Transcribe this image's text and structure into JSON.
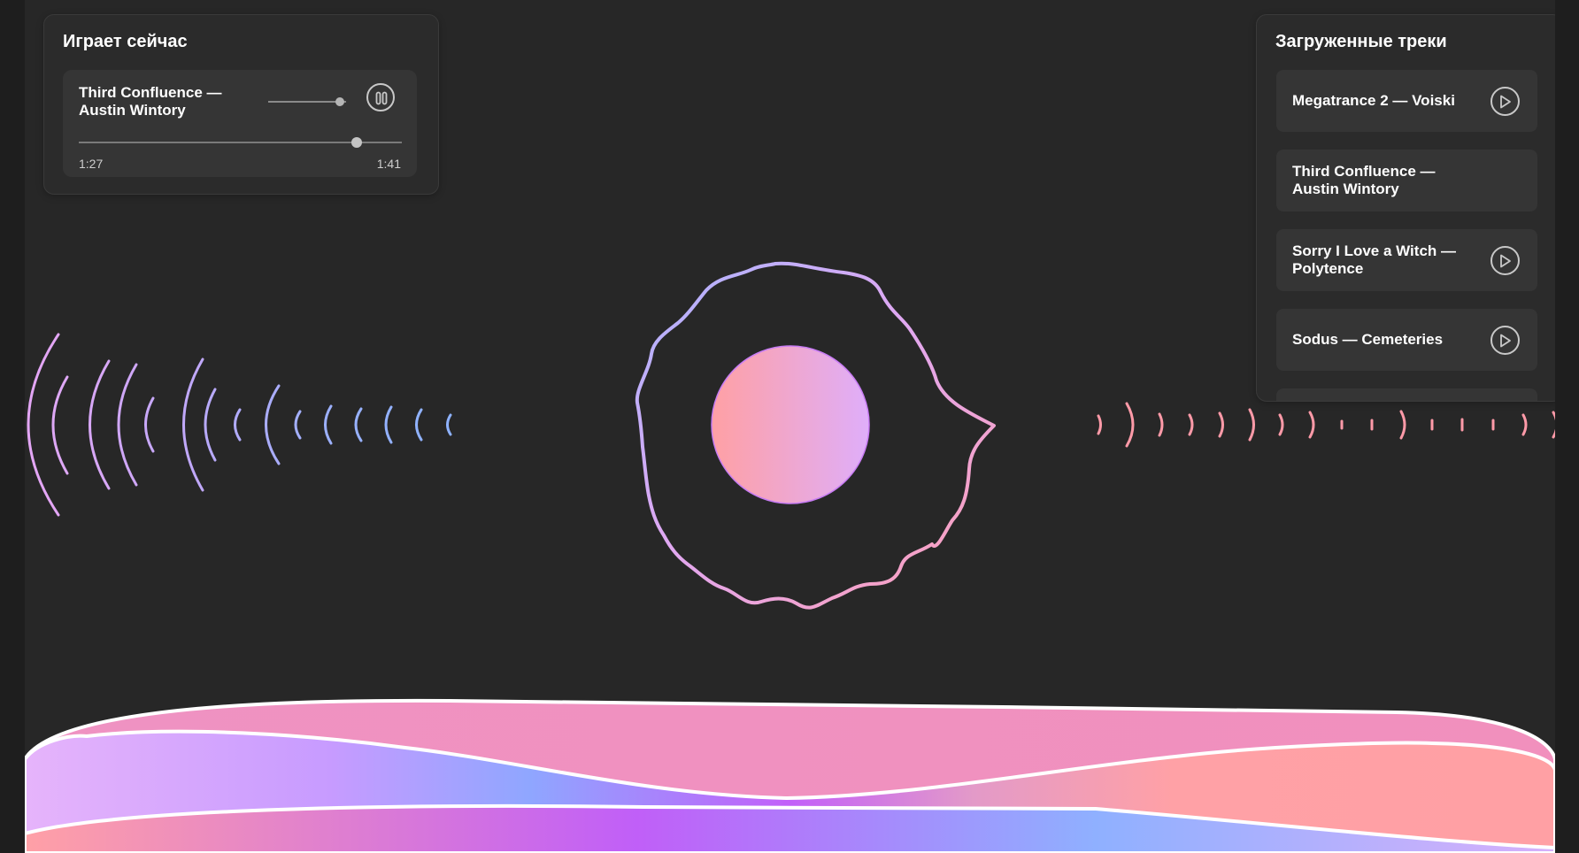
{
  "now_playing": {
    "title": "Играет сейчас",
    "track": "Third Confluence — Austin Wintory",
    "current_time": "1:27",
    "duration": "1:41",
    "progress": 0.86,
    "volume": 0.92
  },
  "loaded_tracks": {
    "title": "Загруженные треки",
    "items": [
      {
        "label": "Megatrance 2 — Voiski",
        "playing": false
      },
      {
        "label": "Third Confluence — Austin Wintory",
        "playing": true
      },
      {
        "label": "Sorry I Love a Witch — Polytence",
        "playing": false
      },
      {
        "label": "Sodus — Cemeteries",
        "playing": false
      },
      {
        "label": "",
        "playing": false
      }
    ]
  },
  "colors": {
    "background": "#272727",
    "panel": "#2b2b2b",
    "card": "#353535",
    "accent_pink": "#ff9fa6",
    "accent_lavender": "#e1aef5",
    "accent_purple": "#c060f8",
    "accent_blue": "#8fb0ff"
  },
  "icons": {
    "pause": "pause-icon",
    "play": "play-icon"
  }
}
